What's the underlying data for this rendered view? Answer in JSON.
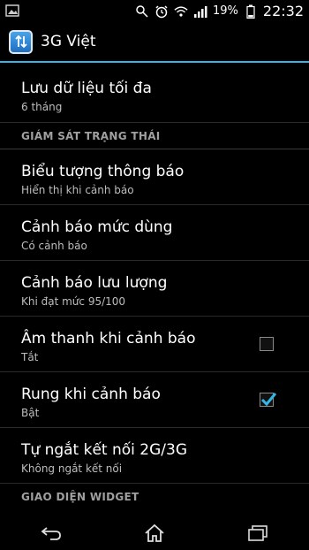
{
  "status": {
    "battery_percent": "19%",
    "time": "22:32"
  },
  "app": {
    "title": "3G Việt"
  },
  "settings": {
    "item0": {
      "title": "Lưu dữ liệu tối đa",
      "subtitle": "6 tháng"
    },
    "section1": "GIÁM SÁT TRẠNG THÁI",
    "item1": {
      "title": "Biểu tượng thông báo",
      "subtitle": "Hiển thị khi cảnh báo"
    },
    "item2": {
      "title": "Cảnh báo mức dùng",
      "subtitle": "Có cảnh báo"
    },
    "item3": {
      "title": "Cảnh báo lưu lượng",
      "subtitle": "Khi đạt mức 95/100"
    },
    "item4": {
      "title": "Âm thanh khi cảnh báo",
      "subtitle": "Tắt",
      "checked": false
    },
    "item5": {
      "title": "Rung khi cảnh báo",
      "subtitle": "Bật",
      "checked": true
    },
    "item6": {
      "title": "Tự ngắt kết nối 2G/3G",
      "subtitle": "Không ngắt kết nối"
    },
    "section2": "GIAO DIỆN WIDGET"
  },
  "colors": {
    "accent": "#33b5e5",
    "background": "#000000"
  },
  "icons": {
    "gallery": "image-icon",
    "sync": "sync-icon",
    "alarm": "alarm-icon",
    "wifi": "wifi-icon",
    "signal": "signal-icon",
    "battery": "battery-icon",
    "back": "back-icon",
    "home": "home-icon",
    "recents": "recents-icon"
  }
}
